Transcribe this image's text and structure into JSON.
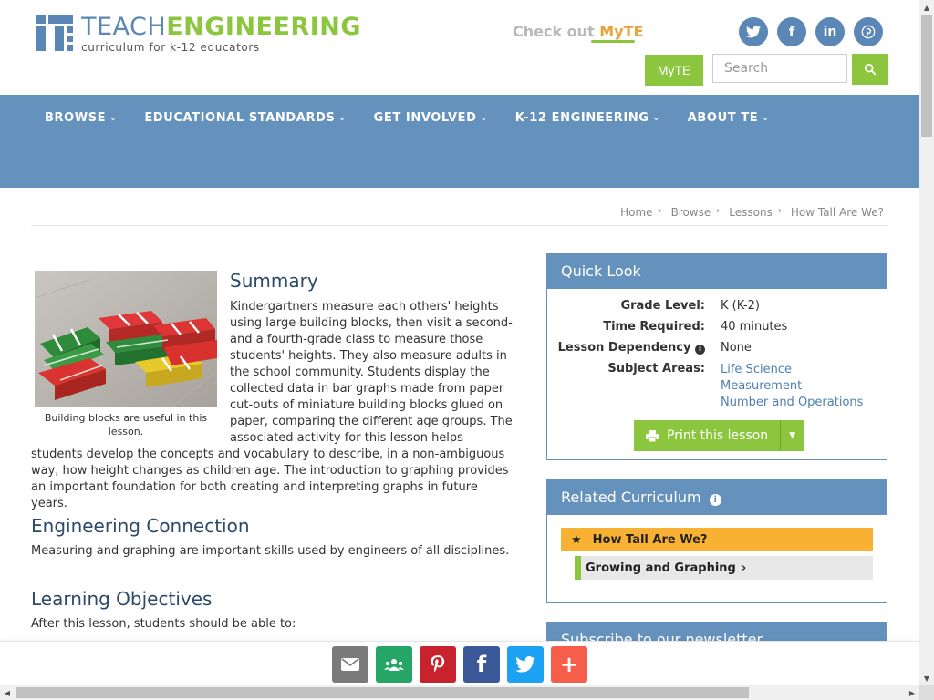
{
  "header": {
    "logo_main_1": "TEACH",
    "logo_main_2": "ENGINEERING",
    "logo_sub": "curriculum for k-12 educators",
    "checkout_prefix": "Check out",
    "checkout_brand": "MyTE",
    "myte_button": "MyTE",
    "social": [
      "twitter-icon",
      "facebook-icon",
      "linkedin-icon",
      "pinterest-icon"
    ]
  },
  "nav": {
    "items": [
      "BROWSE",
      "EDUCATIONAL STANDARDS",
      "GET INVOLVED",
      "K-12 ENGINEERING",
      "ABOUT TE"
    ],
    "search_placeholder": "Search"
  },
  "breadcrumb": [
    "Home",
    "Browse",
    "Lessons",
    "How Tall Are We?"
  ],
  "main": {
    "image_caption": "Building blocks are useful in this lesson.",
    "summary_title": "Summary",
    "summary_text": "Kindergartners measure each others' heights using large building blocks, then visit a second- and a fourth-grade class to measure those students' heights. They also measure adults in the school community. Students display the collected data in bar graphs made from paper cut-outs of miniature building blocks glued on paper, comparing the different age groups. The associated activity for this lesson helps students develop the concepts and vocabulary to describe, in a non-ambiguous way, how height changes as children age. The introduction to graphing provides an important foundation for both creating and interpreting graphs in future years.",
    "engineering_title": "Engineering Connection",
    "engineering_text": "Measuring and graphing are important skills used by engineers of all disciplines.",
    "objectives_title": "Learning Objectives",
    "objectives_text": "After this lesson, students should be able to:"
  },
  "quick_look": {
    "title": "Quick Look",
    "grade_label": "Grade Level:",
    "grade_value": "K (K-2)",
    "time_label": "Time Required:",
    "time_value": "40 minutes",
    "dependency_label": "Lesson Dependency",
    "dependency_value": "None",
    "subject_label": "Subject Areas:",
    "subjects": [
      "Life Science",
      "Measurement",
      "Number and Operations"
    ],
    "print_label": "Print this lesson"
  },
  "related": {
    "title": "Related Curriculum",
    "items": [
      "How Tall Are We?",
      "Growing and Graphing"
    ]
  },
  "newsletter": {
    "title": "Subscribe to our newsletter"
  },
  "share": {
    "buttons": [
      {
        "name": "email-share-icon",
        "color": "#7a7a7a"
      },
      {
        "name": "google-classroom-share-icon",
        "color": "#25a667"
      },
      {
        "name": "pinterest-share-icon",
        "color": "#c8232c"
      },
      {
        "name": "facebook-share-icon",
        "color": "#3b5998"
      },
      {
        "name": "twitter-share-icon",
        "color": "#1da1f2"
      },
      {
        "name": "more-share-icon",
        "color": "#f65e4b"
      }
    ]
  },
  "colors": {
    "brand_blue": "#6492bd",
    "brand_green": "#8cc63f",
    "highlight": "#f8b133"
  }
}
